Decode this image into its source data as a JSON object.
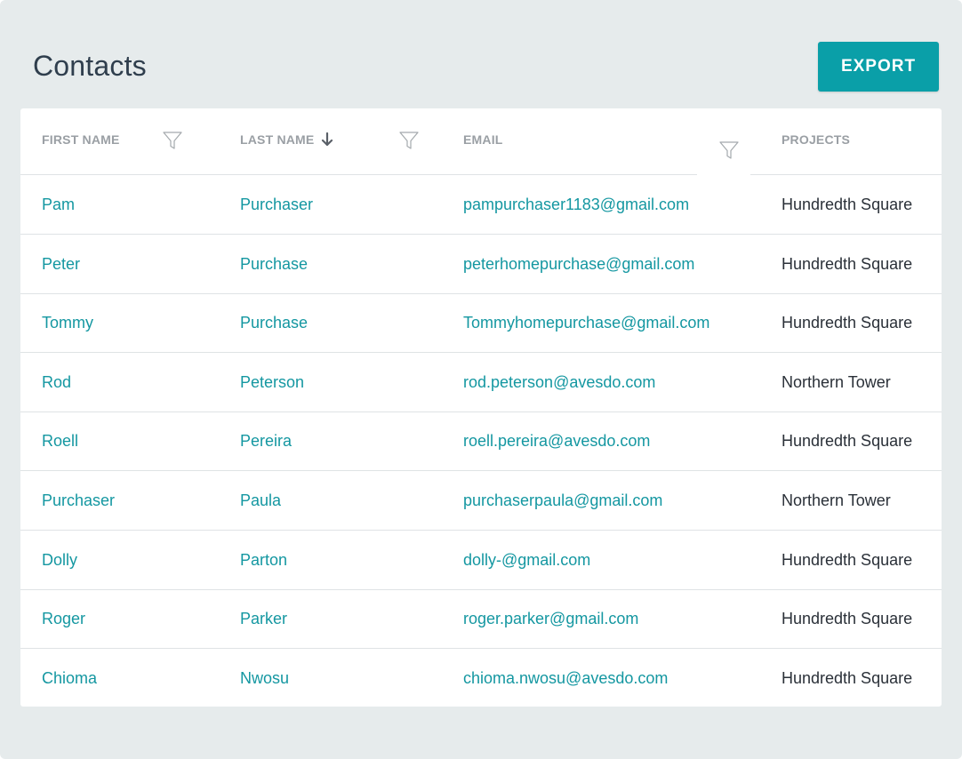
{
  "page": {
    "title": "Contacts"
  },
  "toolbar": {
    "export_label": "EXPORT"
  },
  "colors": {
    "accent": "#0a9fa8",
    "link": "#1497a1",
    "panel_bg": "#e6ebec",
    "header_text": "#9a9fa4"
  },
  "table": {
    "columns": [
      {
        "label": "FIRST NAME",
        "filter_icon": "filter-icon"
      },
      {
        "label": "LAST NAME",
        "sort_icon": "arrow-down-icon",
        "filter_icon": "filter-icon"
      },
      {
        "label": "EMAIL",
        "filter_icon": "filter-icon"
      },
      {
        "label": "PROJECTS"
      }
    ],
    "rows": [
      {
        "first": "Pam",
        "last": "Purchaser",
        "email": "pampurchaser1183@gmail.com",
        "project": "Hundredth Square"
      },
      {
        "first": "Peter",
        "last": "Purchase",
        "email": "peterhomepurchase@gmail.com",
        "project": "Hundredth Square"
      },
      {
        "first": "Tommy",
        "last": "Purchase",
        "email": "Tommyhomepurchase@gmail.com",
        "project": "Hundredth Square"
      },
      {
        "first": "Rod",
        "last": "Peterson",
        "email": "rod.peterson@avesdo.com",
        "project": "Northern Tower"
      },
      {
        "first": "Roell",
        "last": "Pereira",
        "email": "roell.pereira@avesdo.com",
        "project": "Hundredth Square"
      },
      {
        "first": "Purchaser",
        "last": "Paula",
        "email": "purchaserpaula@gmail.com",
        "project": "Northern Tower"
      },
      {
        "first": "Dolly",
        "last": "Parton",
        "email": "dolly-@gmail.com",
        "project": "Hundredth Square"
      },
      {
        "first": "Roger",
        "last": "Parker",
        "email": "roger.parker@gmail.com",
        "project": "Hundredth Square"
      },
      {
        "first": "Chioma",
        "last": "Nwosu",
        "email": "chioma.nwosu@avesdo.com",
        "project": "Hundredth Square"
      }
    ]
  }
}
